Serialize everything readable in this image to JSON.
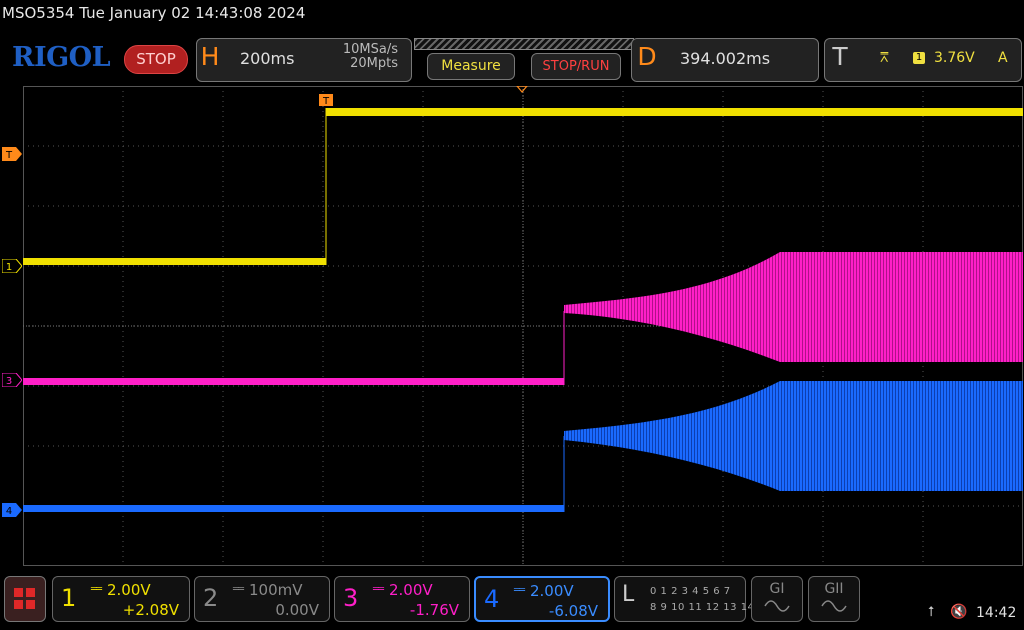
{
  "header": {
    "title": "MSO5354  Tue January 02 14:43:08 2024",
    "brand": "RIGOL",
    "status": "STOP"
  },
  "horizontal": {
    "letter": "H",
    "time_scale": "200ms",
    "sample_rate": "10MSa/s",
    "memory_depth": "20Mpts"
  },
  "toolbar": {
    "measure_label": "Measure",
    "stop_run_label": "STOP/RUN"
  },
  "delay": {
    "letter": "D",
    "value": "394.002ms"
  },
  "trigger": {
    "letter": "T",
    "source": "1",
    "level": "3.76V",
    "mode": "A",
    "marker": "T"
  },
  "channels": [
    {
      "num": "1",
      "scale": "2.00V",
      "offset": "+2.08V",
      "color": "#f0e000",
      "marker": "1"
    },
    {
      "num": "2",
      "scale": "100mV",
      "offset": "0.00V",
      "color": "#8a8a8a",
      "marker": "2"
    },
    {
      "num": "3",
      "scale": "2.00V",
      "offset": "-1.76V",
      "color": "#ff1fc8",
      "marker": "3"
    },
    {
      "num": "4",
      "scale": "2.00V",
      "offset": "-6.08V",
      "color": "#1a6aff",
      "marker": "4"
    }
  ],
  "logic": {
    "letter": "L",
    "row1": "0 1 2 3   4 5 6 7",
    "row2": "8 9 10 11 12 13 14 15"
  },
  "generators": [
    {
      "label": "GI",
      "icon": "sine-wave-icon"
    },
    {
      "label": "GII",
      "icon": "sine-wave-icon"
    }
  ],
  "status_bar": {
    "usb_icon": "usb-icon",
    "speaker_icon": "speaker-muted-icon",
    "time": "14:42"
  },
  "colors": {
    "accent_orange": "#ff8a1a",
    "grid": "#555555",
    "stop_red": "#b12020"
  }
}
